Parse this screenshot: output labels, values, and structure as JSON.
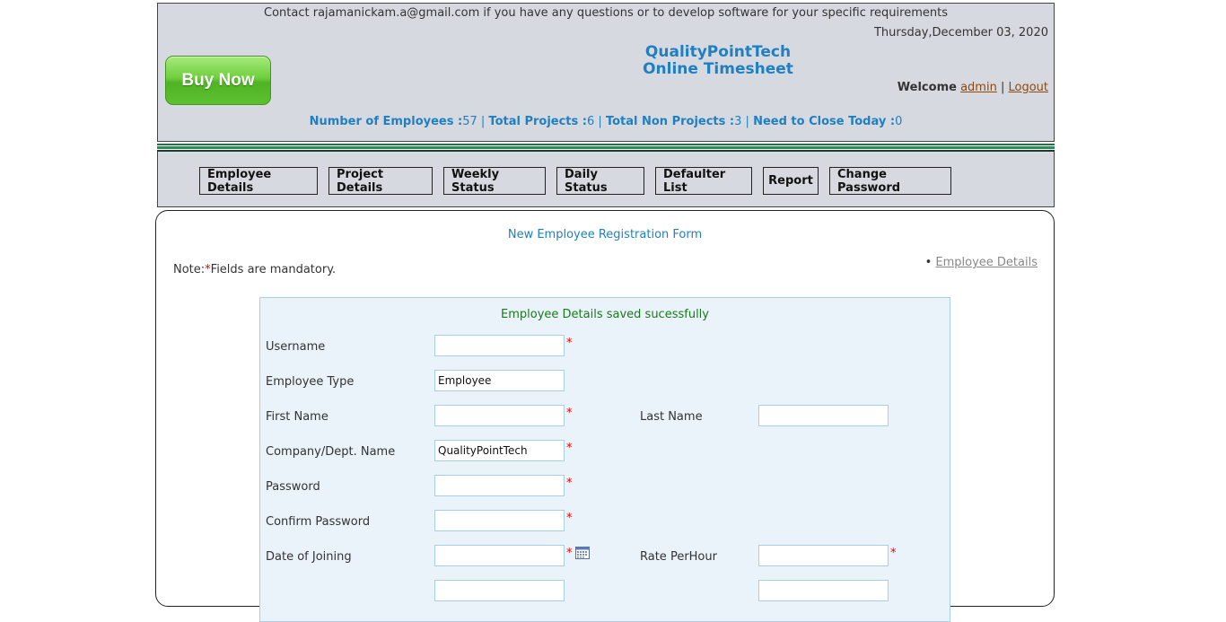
{
  "header": {
    "contact": "Contact rajamanickam.a@gmail.com if you have any questions or to develop software for your specific requirements",
    "date": "Thursday,December 03, 2020",
    "buy_now": "Buy Now",
    "brand_line1": "QualityPointTech",
    "brand_line2": "Online Timesheet",
    "welcome_label": "Welcome",
    "user": "admin",
    "separator": "|",
    "logout": "Logout",
    "stats": {
      "employees_label": "Number of Employees :",
      "employees_value": "57",
      "projects_label": "Total Projects :",
      "projects_value": "6",
      "non_projects_label": "Total Non Projects :",
      "non_projects_value": "3",
      "close_today_label": "Need to Close Today :",
      "close_today_value": "0",
      "sep": "|"
    }
  },
  "nav": {
    "items": [
      {
        "label": "Employee Details"
      },
      {
        "label": "Project Details"
      },
      {
        "label": "Weekly Status"
      },
      {
        "label": "Daily Status"
      },
      {
        "label": "Defaulter List"
      },
      {
        "label": "Report"
      },
      {
        "label": "Change Password"
      }
    ]
  },
  "content": {
    "form_title": "New Employee Registration Form",
    "note_prefix": "Note:",
    "required_mark": "*",
    "note_suffix": "Fields are mandatory.",
    "bullet": "•",
    "employee_details_link": "Employee Details"
  },
  "form": {
    "success_message": "Employee Details saved sucessfully",
    "username": {
      "label": "Username",
      "value": ""
    },
    "employee_type": {
      "label": "Employee Type",
      "value": "Employee"
    },
    "first_name": {
      "label": "First Name",
      "value": ""
    },
    "last_name": {
      "label": "Last Name",
      "value": ""
    },
    "company": {
      "label": "Company/Dept. Name",
      "value": "QualityPointTech"
    },
    "password": {
      "label": "Password",
      "value": ""
    },
    "confirm_password": {
      "label": "Confirm Password",
      "value": ""
    },
    "date_of_joining": {
      "label": "Date of Joining",
      "value": ""
    },
    "rate_per_hour": {
      "label": "Rate PerHour",
      "value": ""
    }
  },
  "colors": {
    "accent_blue": "#1f7fc0",
    "header_bg": "#d6dae0",
    "required_red": "#e00000",
    "success_green": "#1a7a1a",
    "panel_bg": "#eaf2fa"
  }
}
